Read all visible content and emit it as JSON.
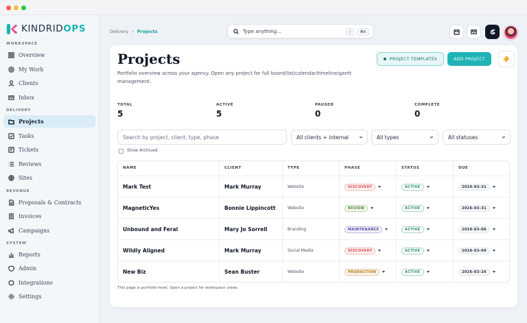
{
  "brand": {
    "logo_prefix": "KINDRID",
    "logo_suffix": "OPS",
    "accent": "#17b3b1"
  },
  "sidebar": {
    "sections": [
      {
        "label": "WORKSPACE",
        "items": [
          {
            "label": "Overview",
            "icon": "grid-icon"
          },
          {
            "label": "My Work",
            "icon": "target-icon"
          },
          {
            "label": "Clients",
            "icon": "user-icon"
          },
          {
            "label": "Inbox",
            "icon": "mail-icon"
          }
        ]
      },
      {
        "label": "DELIVERY",
        "items": [
          {
            "label": "Projects",
            "icon": "folder-icon",
            "active": true
          },
          {
            "label": "Tasks",
            "icon": "check-square-icon"
          },
          {
            "label": "Tickets",
            "icon": "ticket-icon"
          },
          {
            "label": "Reviews",
            "icon": "list-icon"
          },
          {
            "label": "Sites",
            "icon": "globe-icon"
          }
        ]
      },
      {
        "label": "REVENUE",
        "items": [
          {
            "label": "Proposals & Contracts",
            "icon": "document-icon"
          },
          {
            "label": "Invoices",
            "icon": "receipt-icon"
          },
          {
            "label": "Campaigns",
            "icon": "megaphone-icon"
          }
        ]
      },
      {
        "label": "SYSTEM",
        "items": [
          {
            "label": "Reports",
            "icon": "chart-icon"
          },
          {
            "label": "Admin",
            "icon": "shield-icon"
          },
          {
            "label": "Integrations",
            "icon": "hexagon-icon"
          },
          {
            "label": "Settings",
            "icon": "gear-icon"
          }
        ]
      }
    ]
  },
  "topbar": {
    "breadcrumb": {
      "parent": "Delivery",
      "sep": "›",
      "current": "Projects"
    },
    "search": {
      "placeholder": "Type anything...",
      "shortcut1": "/",
      "shortcut2": "⌘K"
    }
  },
  "page": {
    "title": "Projects",
    "subtitle": "Portfolio overview across your agency. Open any project for full board/list/calendar/timeline/gantt management.",
    "templates_button": "PROJECT TEMPLATES",
    "add_button": "ADD PROJECT",
    "stats": [
      {
        "label": "TOTAL",
        "value": "5"
      },
      {
        "label": "ACTIVE",
        "value": "5"
      },
      {
        "label": "PAUSED",
        "value": "0"
      },
      {
        "label": "COMPLETE",
        "value": "0"
      }
    ],
    "filters": {
      "search_placeholder": "Search by project, client, type, phase",
      "clients": "All clients + internal",
      "types": "All types",
      "statuses": "All statuses",
      "show_archived": "Show Archived"
    },
    "table": {
      "headers": [
        "NAME",
        "CLIENT",
        "TYPE",
        "PHASE",
        "STATUS",
        "DUE"
      ],
      "rows": [
        {
          "name": "Mark Test",
          "client": "Mark Murray",
          "type": "Website",
          "phase": "DISCOVERY",
          "status": "ACTIVE",
          "due": "2026-03-31"
        },
        {
          "name": "MagneticYes",
          "client": "Bonnie Lippincott",
          "type": "Website",
          "phase": "REVIEW",
          "status": "ACTIVE",
          "due": "2026-03-31"
        },
        {
          "name": "Unbound and Feral",
          "client": "Mary Jo Sorrell",
          "type": "Branding",
          "phase": "MAINTENANCE",
          "status": "ACTIVE",
          "due": "2026-03-06"
        },
        {
          "name": "Wildly Aligned",
          "client": "Mark Murray",
          "type": "Social Media",
          "phase": "DISCOVERY",
          "status": "ACTIVE",
          "due": "2026-03-09"
        },
        {
          "name": "New Biz",
          "client": "Sean Buster",
          "type": "Website",
          "phase": "PRODUCTION",
          "status": "ACTIVE",
          "due": "2026-03-26"
        }
      ]
    },
    "footnote": "This page is portfolio-level. Open a project for workspace views."
  },
  "phase_colors": {
    "DISCOVERY": "#e5484d",
    "REVIEW": "#4c8a2b",
    "MAINTENANCE": "#4f46a5",
    "PRODUCTION": "#b8730a"
  },
  "status_color": "#1f8a56"
}
